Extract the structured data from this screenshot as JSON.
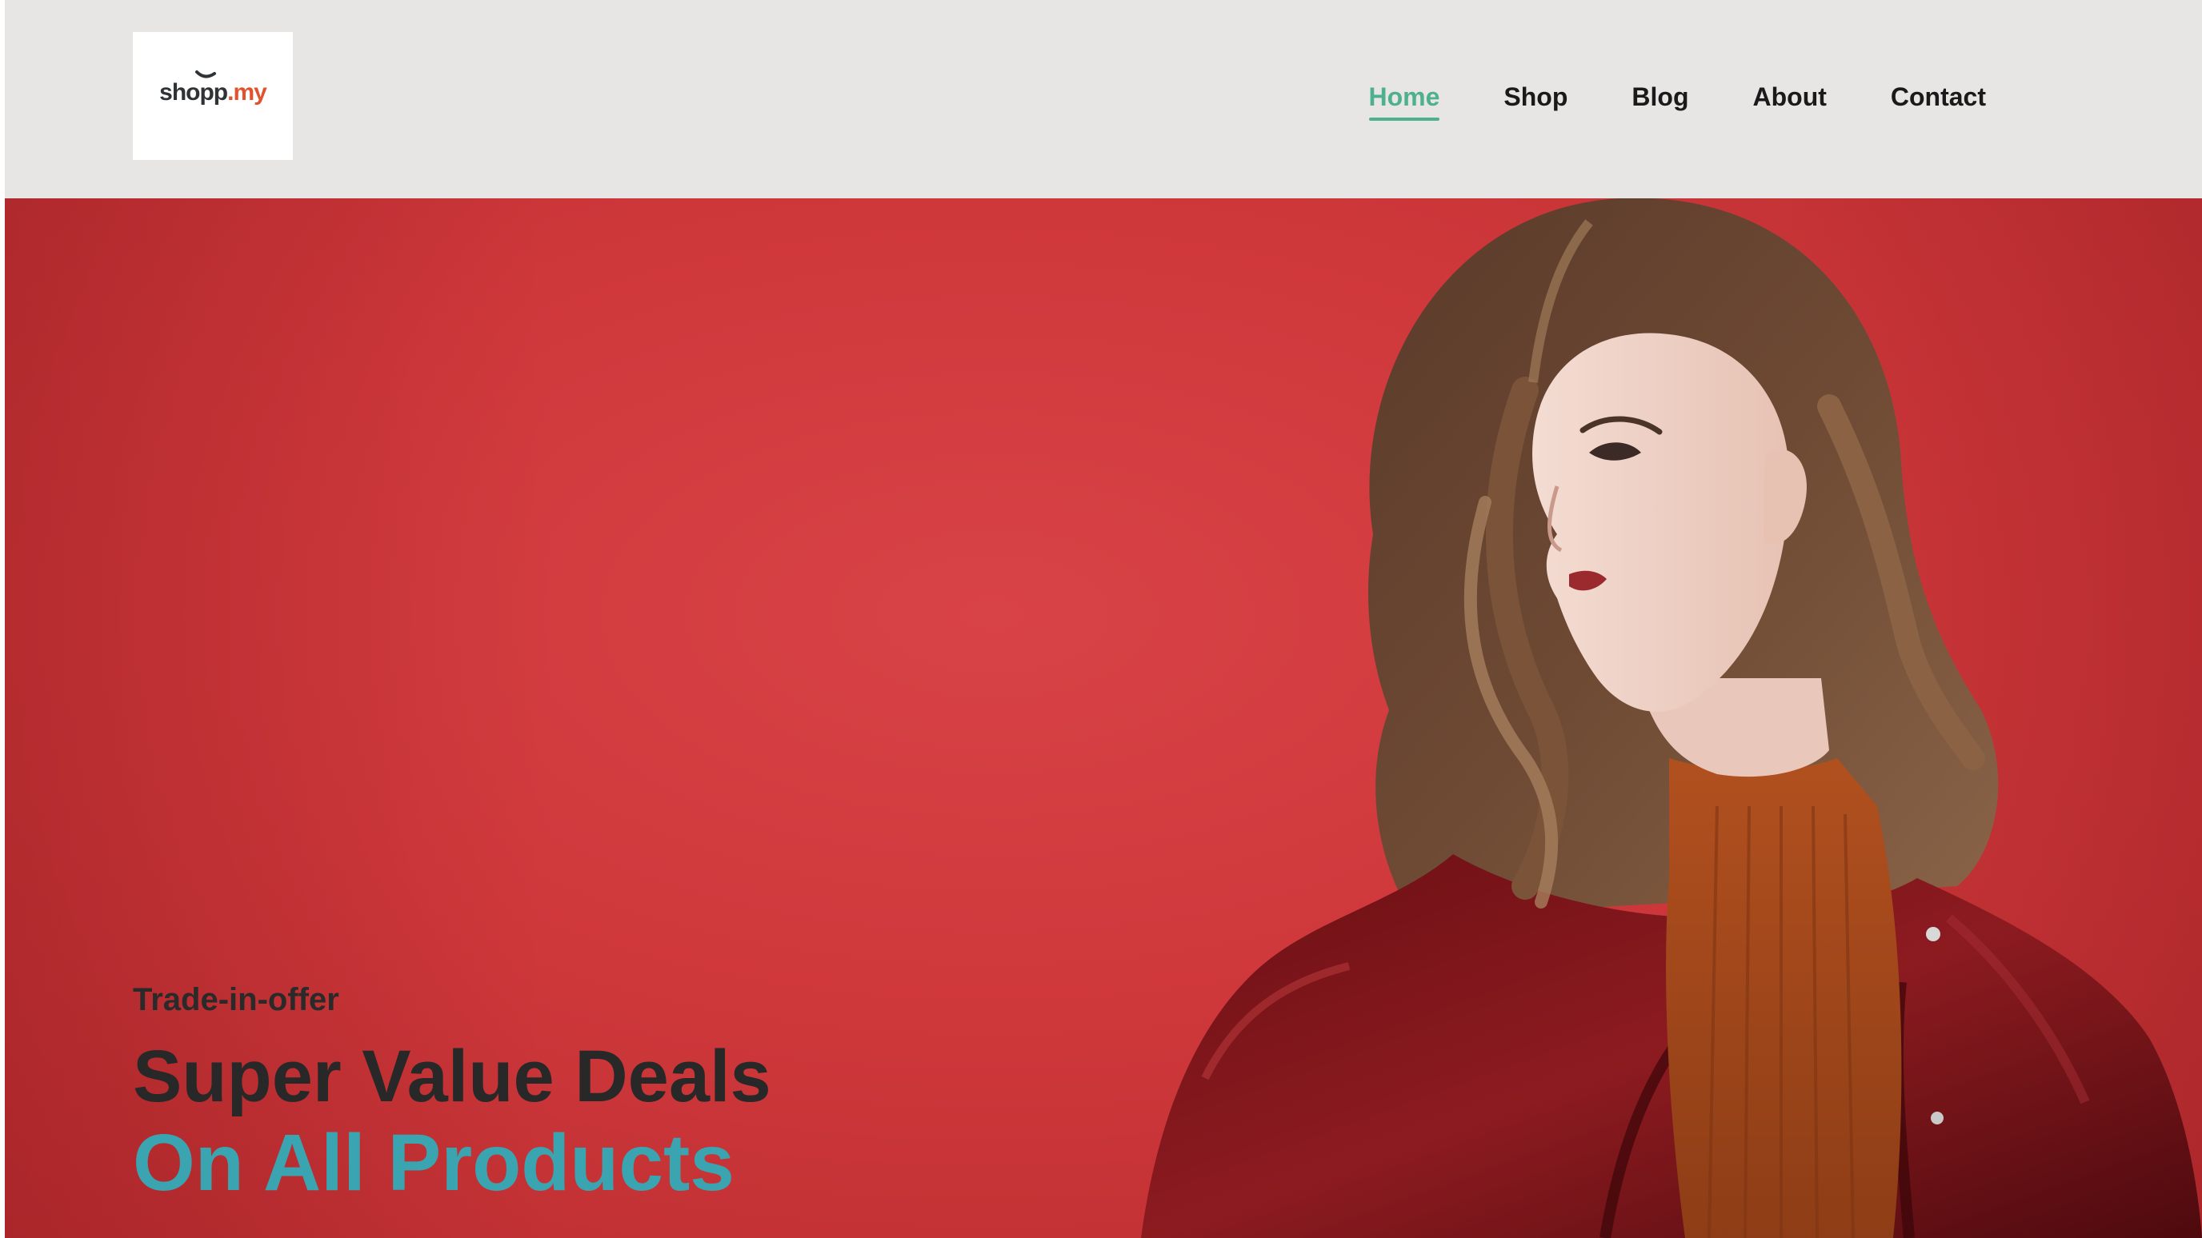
{
  "header": {
    "logo": {
      "name": "shopp",
      "tld": ".my"
    },
    "nav": [
      {
        "label": "Home",
        "active": true
      },
      {
        "label": "Shop",
        "active": false
      },
      {
        "label": "Blog",
        "active": false
      },
      {
        "label": "About",
        "active": false
      },
      {
        "label": "Contact",
        "active": false
      }
    ]
  },
  "hero": {
    "kicker": "Trade-in-offer",
    "headline": "Super Value Deals",
    "subline": "On All Products",
    "image": "model-in-red-leather-jacket"
  },
  "colors": {
    "header_bg": "#e8e5e5",
    "active_nav": "#4db08f",
    "hero_bg": "#d13b3e",
    "headline": "#282828",
    "subline": "#3aa5b0",
    "logo_accent": "#e0532f"
  }
}
